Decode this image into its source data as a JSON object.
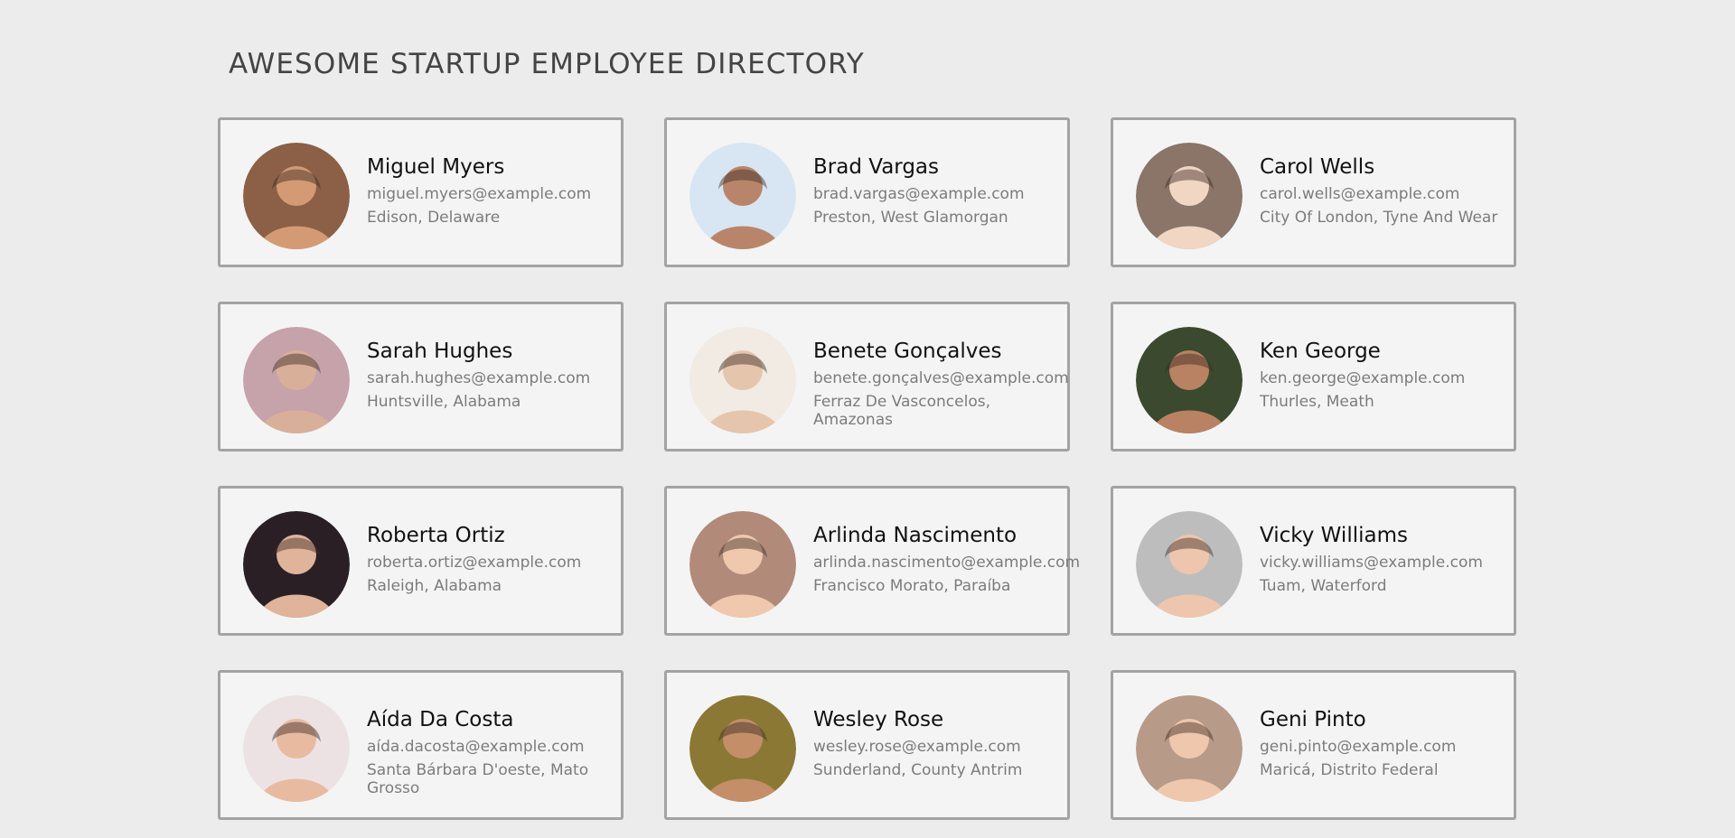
{
  "header": {
    "title": "AWESOME STARTUP EMPLOYEE DIRECTORY"
  },
  "employees": [
    {
      "name": "Miguel Myers",
      "email": "miguel.myers@example.com",
      "location": "Edison, Delaware",
      "avatar_bg": "#8b6047",
      "avatar_fg": "#d49a74"
    },
    {
      "name": "Brad Vargas",
      "email": "brad.vargas@example.com",
      "location": "Preston, West Glamorgan",
      "avatar_bg": "#d7e6f2",
      "avatar_fg": "#b9856a"
    },
    {
      "name": "Carol Wells",
      "email": "carol.wells@example.com",
      "location": "City Of London, Tyne And Wear",
      "avatar_bg": "#8a7568",
      "avatar_fg": "#f0d6c3"
    },
    {
      "name": "Sarah Hughes",
      "email": "sarah.hughes@example.com",
      "location": "Huntsville, Alabama",
      "avatar_bg": "#c6a2ab",
      "avatar_fg": "#d8b09a"
    },
    {
      "name": "Benete Gonçalves",
      "email": "benete.gonçalves@example.com",
      "location": "Ferraz De Vasconcelos, Amazonas",
      "avatar_bg": "#f1ebe3",
      "avatar_fg": "#e6c5ad"
    },
    {
      "name": "Ken George",
      "email": "ken.george@example.com",
      "location": "Thurles, Meath",
      "avatar_bg": "#3b4a2e",
      "avatar_fg": "#b98262"
    },
    {
      "name": "Roberta Ortiz",
      "email": "roberta.ortiz@example.com",
      "location": "Raleigh, Alabama",
      "avatar_bg": "#2b1f26",
      "avatar_fg": "#e0b39b"
    },
    {
      "name": "Arlinda Nascimento",
      "email": "arlinda.nascimento@example.com",
      "location": "Francisco Morato, Paraíba",
      "avatar_bg": "#b18a7a",
      "avatar_fg": "#f0c8ae"
    },
    {
      "name": "Vicky Williams",
      "email": "vicky.williams@example.com",
      "location": "Tuam, Waterford",
      "avatar_bg": "#bdbdbd",
      "avatar_fg": "#eec6ad"
    },
    {
      "name": "Aída Da Costa",
      "email": "aída.dacosta@example.com",
      "location": "Santa Bárbara D'oeste, Mato Grosso",
      "avatar_bg": "#ece2e4",
      "avatar_fg": "#e8bba0"
    },
    {
      "name": "Wesley Rose",
      "email": "wesley.rose@example.com",
      "location": "Sunderland, County Antrim",
      "avatar_bg": "#8b7834",
      "avatar_fg": "#c48e69"
    },
    {
      "name": "Geni Pinto",
      "email": "geni.pinto@example.com",
      "location": "Maricá, Distrito Federal",
      "avatar_bg": "#b79a88",
      "avatar_fg": "#efc7ad"
    }
  ]
}
